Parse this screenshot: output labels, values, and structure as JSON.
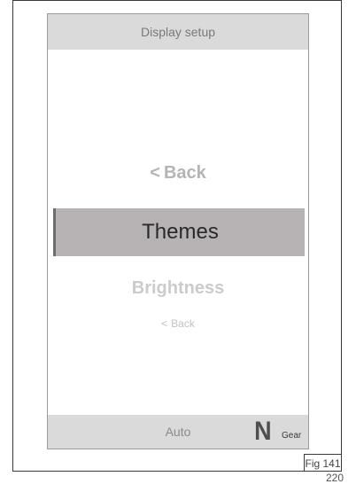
{
  "header": {
    "title": "Display setup"
  },
  "menu": {
    "back_top": "Back",
    "back_glyph": "<",
    "selected": "Themes",
    "next": "Brightness",
    "back_bottom": "Back"
  },
  "footer": {
    "mode": "Auto",
    "gear_value": "N",
    "gear_label": "Gear"
  },
  "figure": {
    "label": "Fig 141",
    "page_number": "220"
  }
}
